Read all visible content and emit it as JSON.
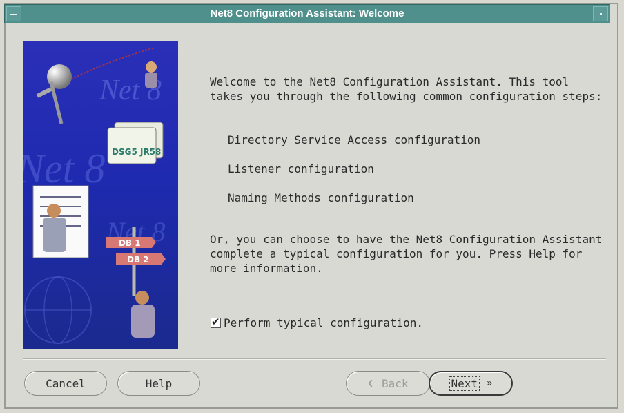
{
  "window": {
    "title": "Net8 Configuration Assistant: Welcome"
  },
  "illustration": {
    "brand": "Net 8",
    "labels": [
      "DB 1",
      "DB 2",
      "DSG5 JR58"
    ]
  },
  "content": {
    "intro": "Welcome to the Net8 Configuration Assistant. This tool takes you through the following common configuration steps:",
    "steps": [
      "Directory Service Access configuration",
      "Listener configuration",
      "Naming Methods configuration"
    ],
    "alternative": "Or, you can choose to have the Net8 Configuration Assistant complete a typical configuration for you. Press Help for more information.",
    "checkbox_label": "Perform typical configuration.",
    "checkbox_checked": true
  },
  "buttons": {
    "cancel": "Cancel",
    "help": "Help",
    "back": "Back",
    "next": "Next",
    "back_enabled": false
  },
  "colors": {
    "titlebar": "#4f8f8c",
    "background": "#d8d9d2",
    "illustration": "#2030b0"
  },
  "icons": [
    "minimize-icon",
    "maximize-icon",
    "back-chevron-icon",
    "next-chevron-icon",
    "checkmark-icon"
  ]
}
